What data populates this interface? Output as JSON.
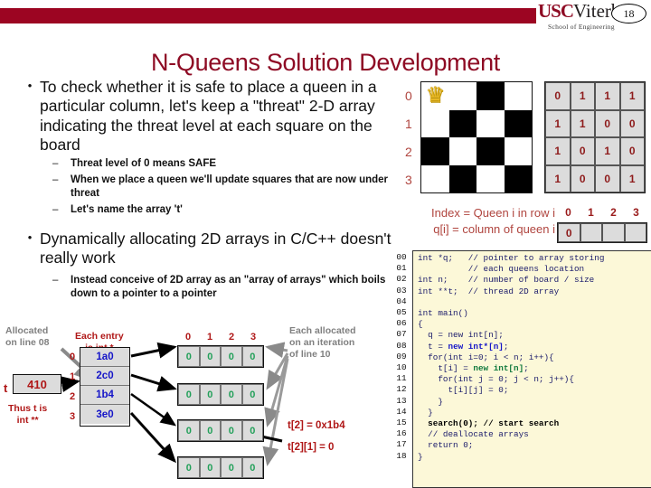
{
  "header": {
    "logo_usc": "USC",
    "logo_viterbi": "Viterbi",
    "logo_school": "School of Engineering",
    "page_number": "18",
    "bar_color": "#9C0522"
  },
  "title": "N-Queens Solution Development",
  "bullets": [
    {
      "level": 1,
      "marker": "•",
      "text": "To check whether it is safe to place a queen in a particular column, let's keep a \"threat\" 2-D array indicating the threat level at each square on the board"
    },
    {
      "level": 2,
      "marker": "–",
      "text": "Threat level of 0 means SAFE"
    },
    {
      "level": 2,
      "marker": "–",
      "text": "When we place a queen we'll update squares that are now under threat"
    },
    {
      "level": 2,
      "marker": "–",
      "text": "Let's name the array 't'"
    },
    {
      "level": 1,
      "marker": "•",
      "text": "Dynamically allocating 2D arrays in C/C++ doesn't really work"
    },
    {
      "level": 2,
      "marker": "–",
      "text": "Instead conceive of 2D array as an \"array of arrays\" which boils down to a pointer to a pointer"
    }
  ],
  "board": {
    "row_labels": [
      "0",
      "1",
      "2",
      "3"
    ],
    "squares": [
      [
        "w",
        "w",
        "b",
        "w"
      ],
      [
        "w",
        "b",
        "w",
        "b"
      ],
      [
        "b",
        "w",
        "b",
        "w"
      ],
      [
        "w",
        "b",
        "w",
        "b"
      ]
    ],
    "queen_glyph": "♛",
    "queen_row": 0,
    "queen_col": 0
  },
  "threat_table": {
    "rows": [
      [
        "0",
        "1",
        "1",
        "1"
      ],
      [
        "1",
        "1",
        "0",
        "0"
      ],
      [
        "1",
        "0",
        "1",
        "0"
      ],
      [
        "1",
        "0",
        "0",
        "1"
      ]
    ]
  },
  "index_caption": {
    "line1": "Index = Queen i in row i",
    "line2": "q[i] = column of queen i"
  },
  "q_array": {
    "headers": [
      "0",
      "1",
      "2",
      "3"
    ],
    "values": [
      "0",
      "",
      "",
      ""
    ]
  },
  "code": {
    "line_numbers": [
      "00",
      "01",
      "02",
      "03",
      "04",
      "05",
      "06",
      "07",
      "08",
      "09",
      "10",
      "11",
      "12",
      "13",
      "14",
      "15",
      "16",
      "17",
      "18"
    ],
    "lines": [
      "int *q;   // pointer to array storing",
      "          // each queens location",
      "int n;    // number of board / size",
      "int **t;  // thread 2D array",
      "",
      "int main()",
      "{",
      "  q = new int[n];",
      "  t = new int*[n];",
      "  for(int i=0; i < n; i++){",
      "    t[i] = new int[n];",
      "    for(int j = 0; j < n; j++){",
      "      t[i][j] = 0;",
      "    }",
      "  }",
      "  search(0); // start search",
      "  // deallocate arrays",
      "  return 0;",
      "}"
    ]
  },
  "diagram": {
    "label_allocated": "Allocated\non line 08",
    "label_each_entry": "Each entry\nis int *",
    "label_each_allocated": "Each allocated\non an iteration\nof line 10",
    "label_thus_t": "Thus t is\nint **",
    "t_var": "t",
    "t_value": "410",
    "pointer_indices": [
      "0",
      "1",
      "2",
      "3"
    ],
    "pointer_values": [
      "1a0",
      "2c0",
      "1b4",
      "3e0"
    ],
    "row_headers": [
      "0",
      "1",
      "2",
      "3"
    ],
    "arrays": [
      [
        "0",
        "0",
        "0",
        "0"
      ],
      [
        "0",
        "0",
        "0",
        "0"
      ],
      [
        "0",
        "0",
        "0",
        "0"
      ],
      [
        "0",
        "0",
        "0",
        "0"
      ]
    ],
    "annot_t2": "t[2] = 0x1b4",
    "annot_t21": "t[2][1] = 0"
  }
}
